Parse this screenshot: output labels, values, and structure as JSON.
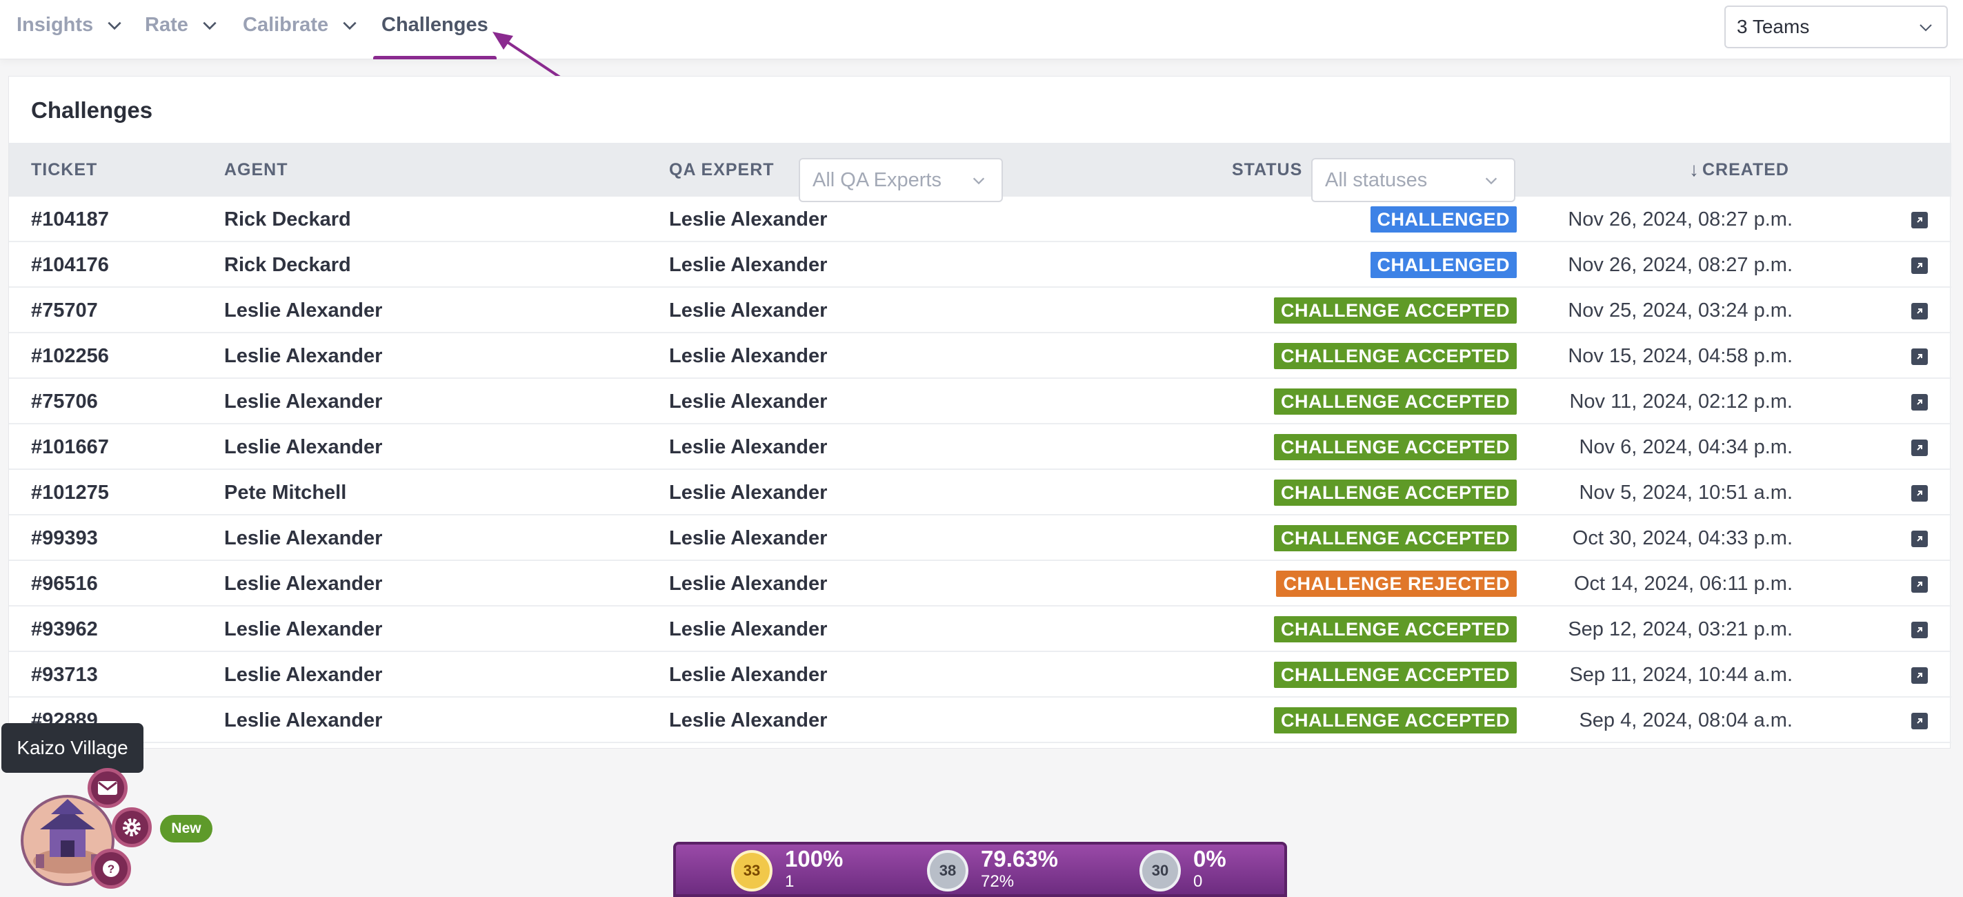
{
  "nav": {
    "tabs": [
      {
        "label": "Insights"
      },
      {
        "label": "Rate"
      },
      {
        "label": "Calibrate"
      },
      {
        "label": "Challenges"
      }
    ],
    "team_select": "3 Teams"
  },
  "panel": {
    "title": "Challenges",
    "headers": {
      "ticket": "TICKET",
      "agent": "AGENT",
      "qa_expert": "QA EXPERT",
      "status": "STATUS",
      "created": "CREATED"
    },
    "filters": {
      "qa_expert_placeholder": "All QA Experts",
      "status_placeholder": "All statuses"
    },
    "rows": [
      {
        "ticket": "#104187",
        "agent": "Rick Deckard",
        "qa": "Leslie Alexander",
        "status": "CHALLENGED",
        "created": "Nov 26, 2024, 08:27 p.m."
      },
      {
        "ticket": "#104176",
        "agent": "Rick Deckard",
        "qa": "Leslie Alexander",
        "status": "CHALLENGED",
        "created": "Nov 26, 2024, 08:27 p.m."
      },
      {
        "ticket": "#75707",
        "agent": "Leslie Alexander",
        "qa": "Leslie Alexander",
        "status": "CHALLENGE ACCEPTED",
        "created": "Nov 25, 2024, 03:24 p.m."
      },
      {
        "ticket": "#102256",
        "agent": "Leslie Alexander",
        "qa": "Leslie Alexander",
        "status": "CHALLENGE ACCEPTED",
        "created": "Nov 15, 2024, 04:58 p.m."
      },
      {
        "ticket": "#75706",
        "agent": "Leslie Alexander",
        "qa": "Leslie Alexander",
        "status": "CHALLENGE ACCEPTED",
        "created": "Nov 11, 2024, 02:12 p.m."
      },
      {
        "ticket": "#101667",
        "agent": "Leslie Alexander",
        "qa": "Leslie Alexander",
        "status": "CHALLENGE ACCEPTED",
        "created": "Nov 6, 2024, 04:34 p.m."
      },
      {
        "ticket": "#101275",
        "agent": "Pete Mitchell",
        "qa": "Leslie Alexander",
        "status": "CHALLENGE ACCEPTED",
        "created": "Nov 5, 2024, 10:51 a.m."
      },
      {
        "ticket": "#99393",
        "agent": "Leslie Alexander",
        "qa": "Leslie Alexander",
        "status": "CHALLENGE ACCEPTED",
        "created": "Oct 30, 2024, 04:33 p.m."
      },
      {
        "ticket": "#96516",
        "agent": "Leslie Alexander",
        "qa": "Leslie Alexander",
        "status": "CHALLENGE REJECTED",
        "created": "Oct 14, 2024, 06:11 p.m."
      },
      {
        "ticket": "#93962",
        "agent": "Leslie Alexander",
        "qa": "Leslie Alexander",
        "status": "CHALLENGE ACCEPTED",
        "created": "Sep 12, 2024, 03:21 p.m."
      },
      {
        "ticket": "#93713",
        "agent": "Leslie Alexander",
        "qa": "Leslie Alexander",
        "status": "CHALLENGE ACCEPTED",
        "created": "Sep 11, 2024, 10:44 a.m."
      },
      {
        "ticket": "#92889",
        "agent": "Leslie Alexander",
        "qa": "Leslie Alexander",
        "status": "CHALLENGE ACCEPTED",
        "created": "Sep 4, 2024, 08:04 a.m."
      }
    ]
  },
  "status_colors": {
    "CHALLENGED": "#3d82e6",
    "CHALLENGE ACCEPTED": "#5f9a27",
    "CHALLENGE REJECTED": "#e0772a"
  },
  "widget": {
    "tooltip": "Kaizo Village",
    "new_badge": "New",
    "scores": [
      {
        "rank": "33",
        "pct": "100%",
        "sub": "1",
        "medal": "gold"
      },
      {
        "rank": "38",
        "pct": "79.63%",
        "sub": "72%",
        "medal": "silver"
      },
      {
        "rank": "30",
        "pct": "0%",
        "sub": "0",
        "medal": "silver"
      }
    ]
  }
}
